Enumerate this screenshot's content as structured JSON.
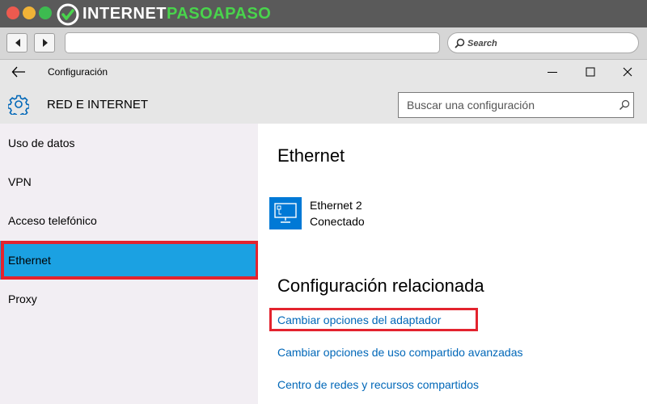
{
  "browser": {
    "brand": {
      "part1": "INTERNET",
      "part2": "PASOAPASO",
      "logo_icon": "check-circle-icon"
    },
    "back_icon": "left-arrow-icon",
    "forward_icon": "right-arrow-icon",
    "url": "",
    "search_label": "Search"
  },
  "window": {
    "title": "Configuración",
    "back_icon": "arrow-left-icon",
    "controls": [
      "minimize-icon",
      "maximize-icon",
      "close-icon"
    ]
  },
  "header": {
    "icon": "gear-icon",
    "title": "RED E INTERNET",
    "search_placeholder": "Buscar una configuración"
  },
  "sidebar": {
    "items": [
      {
        "label": "Uso de datos"
      },
      {
        "label": "VPN"
      },
      {
        "label": "Acceso telefónico"
      },
      {
        "label": "Ethernet",
        "selected": true
      },
      {
        "label": "Proxy"
      }
    ]
  },
  "main": {
    "heading": "Ethernet",
    "connection": {
      "name": "Ethernet 2",
      "status": "Conectado",
      "icon": "ethernet-monitor-icon"
    },
    "related_heading": "Configuración relacionada",
    "links": [
      "Cambiar opciones del adaptador",
      "Cambiar opciones de uso compartido avanzadas",
      "Centro de redes y recursos compartidos"
    ]
  },
  "colors": {
    "accent": "#1ba1e2",
    "link": "#0067b8",
    "highlight": "#e3232e",
    "sidebar_bg": "#f2eef3",
    "header_bg": "#e6e6e6",
    "tile": "#0079d6"
  }
}
